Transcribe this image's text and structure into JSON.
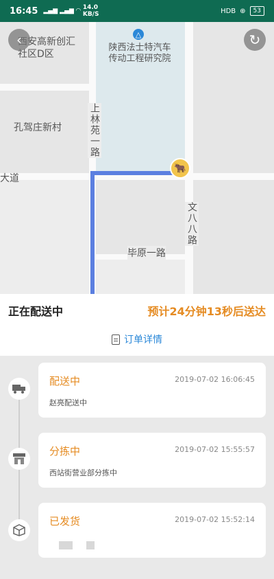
{
  "status_bar": {
    "time": "16:45",
    "signal_left": "5G",
    "network_speed": "14.0",
    "network_speed_unit": "KB/S",
    "hd_label": "HDB",
    "battery": "53"
  },
  "map": {
    "area_label": "西安高新创汇社区D区",
    "poi_name": "陕西法士特汽车传动工程研究院",
    "village_label": "孔驾庄新村",
    "road_1": "上林苑一路",
    "road_2": "大道",
    "road_3": "文八八路",
    "road_4": "毕原一路"
  },
  "header": {
    "status_title": "正在配送中",
    "eta": "预计24分钟13秒后送达",
    "detail_link": "订单详情"
  },
  "timeline": [
    {
      "title": "配送中",
      "time": "2019-07-02 16:06:45",
      "desc": "赵亮配送中",
      "icon": "truck-icon"
    },
    {
      "title": "分拣中",
      "time": "2019-07-02 15:55:57",
      "desc": "西站街营业部分拣中",
      "icon": "store-icon"
    },
    {
      "title": "已发货",
      "time": "2019-07-02 15:52:14",
      "desc": "",
      "icon": "box-icon"
    }
  ],
  "colors": {
    "status_bar_bg": "#0f6b52",
    "accent_orange": "#e58b22",
    "link_blue": "#2b88d8",
    "route_blue": "#5b7fe0"
  }
}
